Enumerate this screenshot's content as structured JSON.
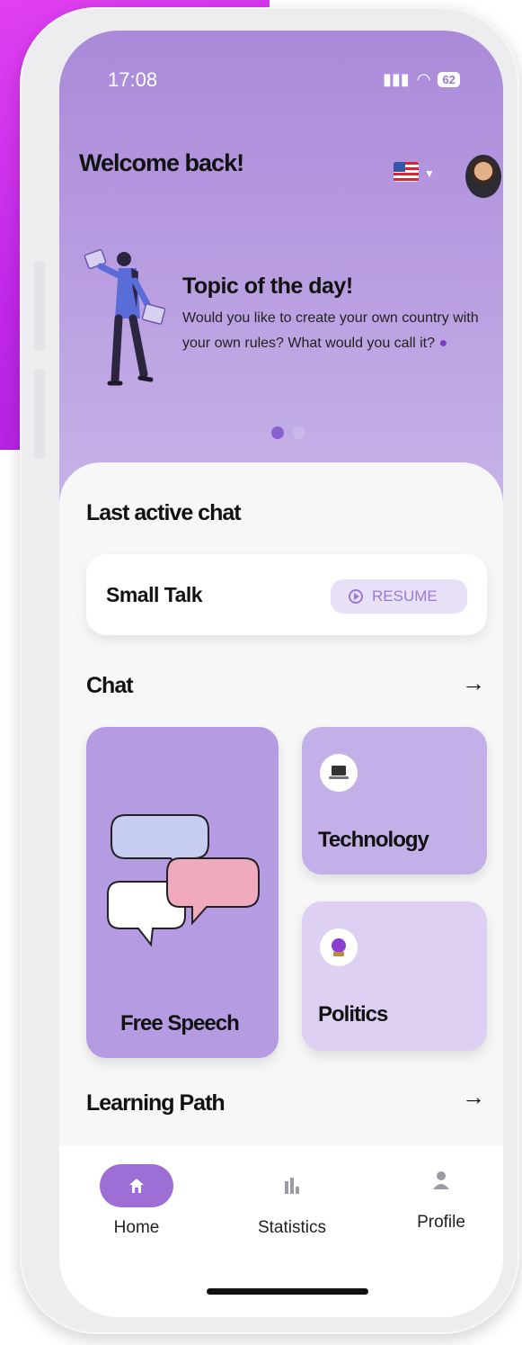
{
  "status": {
    "time": "17:08",
    "battery": "62"
  },
  "header": {
    "welcome": "Welcome back!"
  },
  "topic": {
    "title": "Topic of the day!",
    "text": "Would you like to create your own country with your own rules? What would you call it?",
    "page_index": 1,
    "page_count": 2
  },
  "last_active": {
    "heading": "Last active chat",
    "chat_title": "Small Talk",
    "resume_label": "RESUME"
  },
  "chat": {
    "heading": "Chat",
    "arrow": "→",
    "tiles": [
      {
        "label": "Free Speech",
        "icon": "speech-bubbles-icon"
      },
      {
        "label": "Technology",
        "icon": "laptop-icon"
      },
      {
        "label": "Politics",
        "icon": "crystal-ball-icon"
      }
    ]
  },
  "learning": {
    "heading": "Learning Path",
    "arrow": "→"
  },
  "nav": {
    "items": [
      {
        "label": "Home",
        "icon": "home-icon",
        "active": true
      },
      {
        "label": "Statistics",
        "icon": "bar-chart-icon",
        "active": false
      },
      {
        "label": "Profile",
        "icon": "person-icon",
        "active": false
      }
    ]
  },
  "colors": {
    "accent": "#9d6fd6",
    "hero_top": "#a98ad9",
    "hero_bottom": "#c8b6e9",
    "tile_free_speech": "#b59be2",
    "tile_technology": "#c4b0e8",
    "tile_politics": "#ddd0f2",
    "magenta_bg": "#c028e8"
  }
}
